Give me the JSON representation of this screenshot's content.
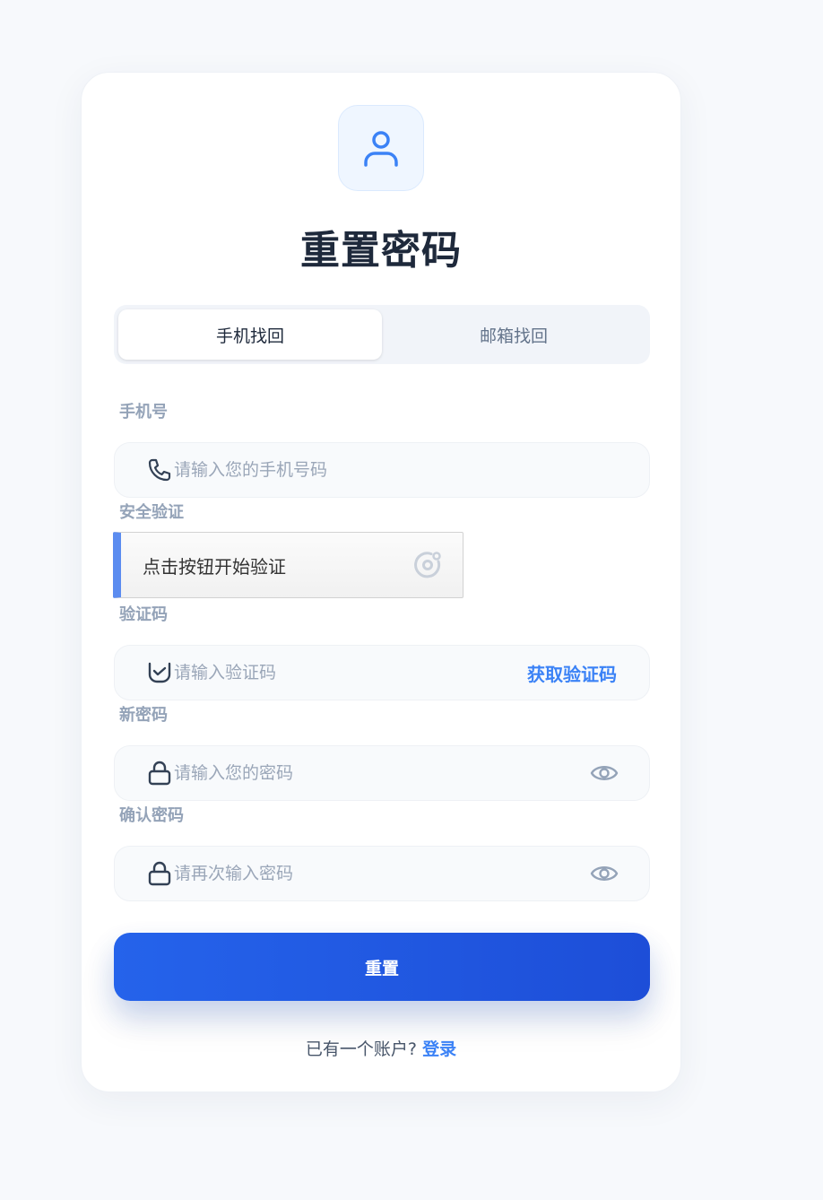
{
  "page": {
    "title": "重置密码",
    "accent_color": "#2563eb",
    "avatar_icon": "user-icon"
  },
  "tabs": [
    {
      "label": "手机找回",
      "active": true
    },
    {
      "label": "邮箱找回",
      "active": false
    }
  ],
  "form": {
    "phone": {
      "label": "手机号",
      "placeholder": "请输入您的手机号码",
      "value": "",
      "icon": "phone-icon"
    },
    "security": {
      "label": "安全验证",
      "button_text": "点击按钮开始验证",
      "icon": "captcha-icon"
    },
    "code": {
      "label": "验证码",
      "placeholder": "请输入验证码",
      "value": "",
      "icon": "shield-check-icon",
      "action_label": "获取验证码"
    },
    "new_password": {
      "label": "新密码",
      "placeholder": "请输入您的密码",
      "value": "",
      "icon": "lock-icon"
    },
    "confirm_password": {
      "label": "确认密码",
      "placeholder": "请再次输入密码",
      "value": "",
      "icon": "lock-icon"
    }
  },
  "submit_label": "重置",
  "footer": {
    "text": "已有一个账户?",
    "link_label": "登录"
  }
}
